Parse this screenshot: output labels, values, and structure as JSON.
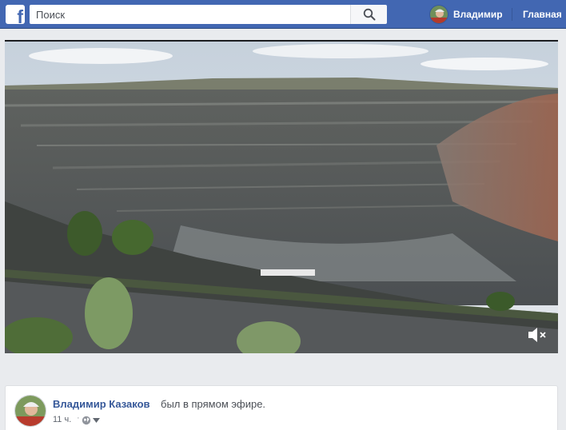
{
  "header": {
    "logo_letter": "f",
    "search_placeholder": "Поиск",
    "user_name": "Владимир",
    "home_label": "Главная"
  },
  "video": {
    "muted": true
  },
  "post": {
    "author": "Владимир Казаков",
    "action": "был в прямом эфире.",
    "time": "11 ч.",
    "separator": "·"
  },
  "colors": {
    "brand_blue": "#4267b2",
    "link_blue": "#365899",
    "background": "#e9ebee"
  },
  "icons": {
    "logo": "facebook-logo",
    "search": "search-icon",
    "mute": "speaker-muted-icon",
    "privacy": "globe-icon",
    "menu": "caret-down-icon"
  }
}
